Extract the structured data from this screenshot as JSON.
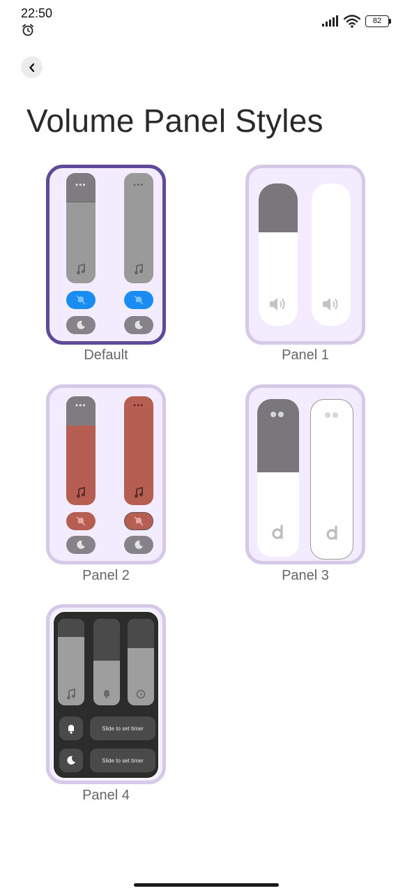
{
  "status_bar": {
    "time": "22:50",
    "battery": "82",
    "icons": [
      "alarm-icon",
      "signal-icon",
      "wifi-icon",
      "battery-icon"
    ]
  },
  "header": {
    "back_icon": "chevron-left-icon",
    "title": "Volume Panel Styles"
  },
  "styles": [
    {
      "label": "Default",
      "selected": true
    },
    {
      "label": "Panel 1",
      "selected": false
    },
    {
      "label": "Panel 2",
      "selected": false
    },
    {
      "label": "Panel 3",
      "selected": false
    },
    {
      "label": "Panel 4",
      "selected": false
    }
  ],
  "panel4": {
    "timer_text_1": "Slide to set timer",
    "timer_text_2": "Slide to set timer"
  },
  "colors": {
    "selected_border": "#5e4a98",
    "card_border": "#d5c9e8",
    "card_bg": "#f3ecff",
    "accent_blue": "#1a8df2",
    "panel2_red": "#b75e52"
  }
}
